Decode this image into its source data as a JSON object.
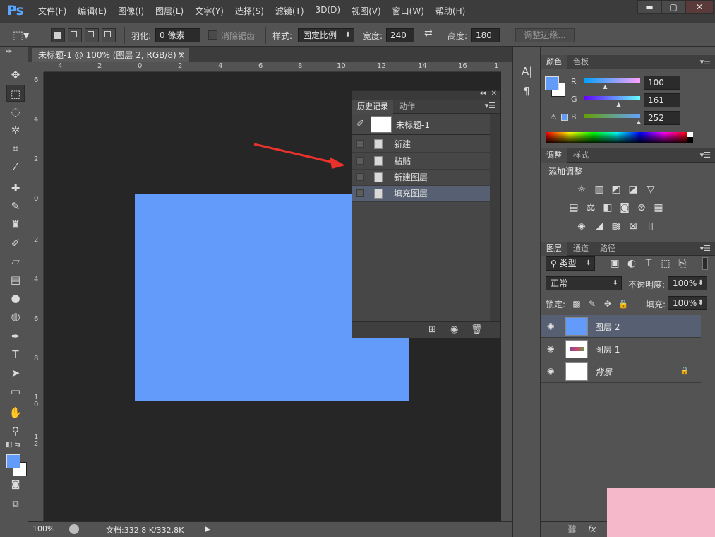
{
  "app": {
    "logo": "Ps"
  },
  "menu": [
    "文件(F)",
    "编辑(E)",
    "图像(I)",
    "图层(L)",
    "文字(Y)",
    "选择(S)",
    "滤镜(T)",
    "3D(D)",
    "视图(V)",
    "窗口(W)",
    "帮助(H)"
  ],
  "window_controls": {
    "minimize": "▬",
    "maximize": "▢",
    "close": "✕"
  },
  "options": {
    "feather_label": "羽化:",
    "feather_value": "0 像素",
    "antialias_label": "消除锯齿",
    "style_label": "样式:",
    "style_value": "固定比例",
    "width_label": "宽度:",
    "width_value": "240",
    "swap_icon": "⇄",
    "height_label": "高度:",
    "height_value": "180",
    "refine_edge": "调整边缘..."
  },
  "document": {
    "tab_title": "未标题-1 @ 100% (图层 2, RGB/8) *",
    "tab_close": "×",
    "fill_color": "#639bfa",
    "zoom": "100%",
    "doc_info": "文档:332.8 K/332.8K",
    "ruler_h": [
      "4",
      "2",
      "0",
      "2",
      "4",
      "6",
      "8",
      "10",
      "12",
      "14",
      "16",
      "1"
    ],
    "ruler_v": [
      "6",
      "4",
      "2",
      "0",
      "2",
      "4",
      "6",
      "8",
      "1 0",
      "1 2"
    ]
  },
  "history": {
    "tabs": [
      "历史记录",
      "动作"
    ],
    "snapshot": "未标题-1",
    "items": [
      {
        "label": "新建",
        "selected": false
      },
      {
        "label": "粘贴",
        "selected": false
      },
      {
        "label": "新建图层",
        "selected": false
      },
      {
        "label": "填充图层",
        "selected": true
      }
    ]
  },
  "color_panel": {
    "tabs": [
      "颜色",
      "色板"
    ],
    "r_label": "R",
    "g_label": "G",
    "b_label": "B",
    "r_value": "100",
    "g_value": "161",
    "b_value": "252",
    "r": 100,
    "g": 161,
    "b": 252,
    "foreground": "#639bfa"
  },
  "adjust_panel": {
    "tabs": [
      "调整",
      "样式"
    ],
    "title": "添加调整"
  },
  "layers_panel": {
    "tabs": [
      "图层",
      "通道",
      "路径"
    ],
    "filter_label": "类型",
    "blend_mode": "正常",
    "opacity_label": "不透明度:",
    "opacity_value": "100%",
    "lock_label": "锁定:",
    "fill_label": "填充:",
    "fill_value": "100%",
    "layers": [
      {
        "name": "图层 2",
        "selected": true,
        "thumb": "#639bfa"
      },
      {
        "name": "图层 1",
        "selected": false,
        "thumb": "#ffffff"
      },
      {
        "name": "背景",
        "selected": false,
        "thumb": "#ffffff"
      }
    ]
  },
  "colors": {
    "accent_blue": "#639bfa",
    "selection": "#566072",
    "arrow_red": "#e8322b"
  }
}
